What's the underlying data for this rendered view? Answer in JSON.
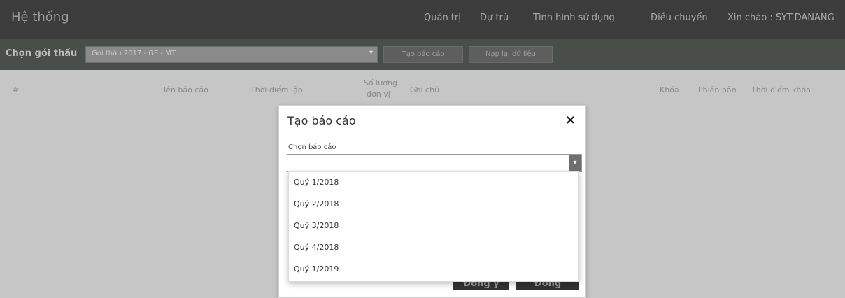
{
  "topbar": {
    "brand": "Hệ thống",
    "nav": [
      "Quản trị",
      "Dự trù",
      "Tình hình sử dụng",
      "Điều chuyển"
    ],
    "greeting": "Xin chào : SYT.DANANG"
  },
  "toolbar": {
    "label": "Chọn gói thầu",
    "select_value": "Gói thầu 2017 - GE - MT",
    "create_report": "Tạo báo cáo",
    "reload": "Nạp lại dữ liệu"
  },
  "table": {
    "columns": [
      "#",
      "Tên báo cáo",
      "Thời điểm lập",
      "Số lượng",
      "đơn vị",
      "Ghi chú",
      "Khóa",
      "Phiên bản",
      "Thời điểm khóa"
    ]
  },
  "dialog": {
    "title": "Tạo báo cáo",
    "close": "×",
    "field_label": "Chọn báo cáo",
    "input_value": "",
    "options": [
      "Quý 1/2018",
      "Quý 2/2018",
      "Quý 3/2018",
      "Quý 4/2018",
      "Quý 1/2019"
    ],
    "ok": "Đồng ý",
    "close_btn": "Đóng"
  },
  "icons": {
    "close": "close-icon",
    "caret": "chevron-down-icon"
  },
  "colors": {
    "topbar": "#3c3c3c",
    "toolbar": "#4a4e4a",
    "overlay": "#c6c6c6",
    "dialog": "#ffffff"
  }
}
